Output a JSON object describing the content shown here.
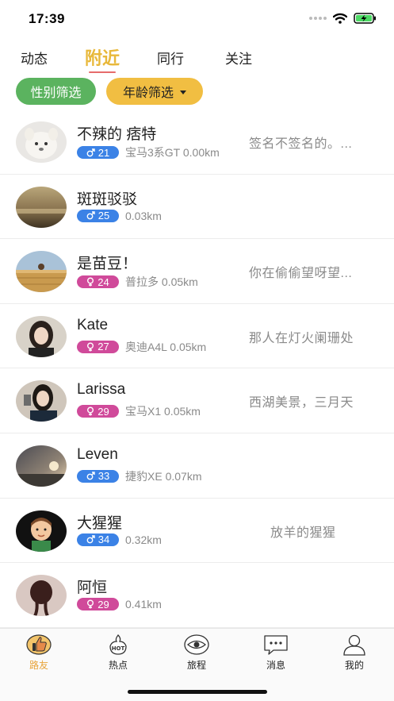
{
  "status_bar": {
    "time": "17:39"
  },
  "top_tabs": [
    {
      "label": "动态",
      "active": false
    },
    {
      "label": "附近",
      "active": true
    },
    {
      "label": "同行",
      "active": false
    },
    {
      "label": "关注",
      "active": false
    }
  ],
  "filters": {
    "gender": "性别筛选",
    "age": "年龄筛选"
  },
  "users": [
    {
      "name": "不辣的 痞特",
      "gender": "male",
      "age": "21",
      "meta": "宝马3系GT 0.00km",
      "signature": "签名不签名的。..."
    },
    {
      "name": "斑斑驳驳",
      "gender": "male",
      "age": "25",
      "meta": "0.03km",
      "signature": ""
    },
    {
      "name": "是苗豆！",
      "gender": "female",
      "age": "24",
      "meta": "普拉多 0.05km",
      "signature": "你在偷偷望呀望..."
    },
    {
      "name": "Kate",
      "gender": "female",
      "age": "27",
      "meta": "奥迪A4L 0.05km",
      "signature": "那人在灯火阑珊处"
    },
    {
      "name": "Larissa",
      "gender": "female",
      "age": "29",
      "meta": "宝马X1 0.05km",
      "signature": "西湖美景，三月天"
    },
    {
      "name": "Leven",
      "gender": "male",
      "age": "33",
      "meta": "捷豹XE 0.07km",
      "signature": ""
    },
    {
      "name": "大猩猩",
      "gender": "male",
      "age": "34",
      "meta": "0.32km",
      "signature": "放羊的猩猩"
    },
    {
      "name": "阿恒",
      "gender": "female",
      "age": "29",
      "meta": "0.41km",
      "signature": ""
    }
  ],
  "tab_bar": [
    {
      "label": "路友",
      "icon": "thumbs-up-icon",
      "active": true
    },
    {
      "label": "热点",
      "icon": "hot-icon",
      "active": false
    },
    {
      "label": "旅程",
      "icon": "eye-icon",
      "active": false
    },
    {
      "label": "消息",
      "icon": "message-icon",
      "active": false
    },
    {
      "label": "我的",
      "icon": "profile-icon",
      "active": false
    }
  ],
  "colors": {
    "accent": "#e8b83a",
    "male": "#3b82e6",
    "female": "#d04a9a",
    "gender_filter": "#5bb35f",
    "age_filter": "#f1be42"
  }
}
